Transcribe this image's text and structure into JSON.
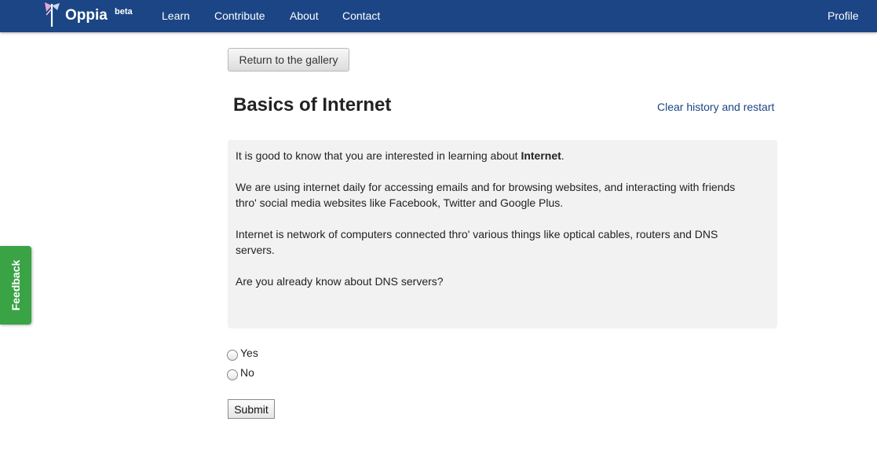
{
  "navbar": {
    "brand": "Oppia",
    "badge": "beta",
    "links": [
      "Learn",
      "Contribute",
      "About",
      "Contact"
    ],
    "profile": "Profile",
    "logo_icon": "oppia-logo-icon",
    "background": "#1b4585"
  },
  "gallery_button": "Return to the gallery",
  "exploration": {
    "title": "Basics of Internet",
    "clear_link": "Clear history and restart",
    "intro_before": "It is good to know that you are interested in learning about ",
    "intro_bold": "Internet",
    "intro_after": ".",
    "para2": "We are using internet daily for accessing emails and for browsing websites, and interacting with friends thro' social media websites like Facebook, Twitter and Google Plus.",
    "para3": "Internet is network of computers connected thro' various things like optical cables, routers and DNS servers.",
    "para4": "Are you already know about DNS servers?"
  },
  "options": [
    "Yes",
    "No"
  ],
  "submit": "Submit",
  "feedback": {
    "label": "Feedback",
    "color": "#3aa345"
  }
}
